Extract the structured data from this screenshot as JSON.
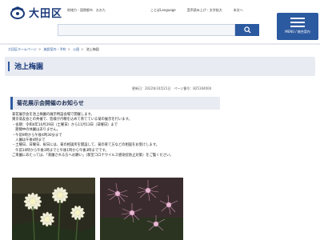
{
  "header": {
    "logo_text": "大田区",
    "logo_sub": "地域力・国際都市　おおた",
    "util_links": [
      "ことばLanguage",
      "音声読み上げ・文字拡大",
      "本文へ"
    ],
    "search_placeholder": "",
    "menu_label": "MENU / 総合案内"
  },
  "breadcrumb": [
    "大田区ホームページ",
    "施設案内・予約",
    "公園",
    "池上梅園"
  ],
  "page": {
    "title": "池上梅園",
    "meta": "更新日：2022年10月21日　ページ番号：825164004"
  },
  "section": {
    "title": "菊花展示会開催のお知らせ",
    "lines": [
      "菊花展示会を池上梅園の展示特設会場で開催します。",
      "東京菊友会との共催で、皆様が丹精を込めて育てている菊の展示を行います。",
      "・会期：令和4年10月29日（土曜日）から11月13日（日曜日）まで",
      "　期間中の休園はありません。",
      "・午前9時から午後4時30分まで",
      "　入園は午後4時まで",
      "・土曜日、日曜日、祝日には、菊の相談所を開設して、菊の育て方などの相談をお受けします。",
      "　午前10時から午後3時までと午後1時から午後3時までです。",
      "ご来園にあたっては、「来園される方へお願い」（新型コロナウイルス感染症防止対策）をご覧ください。"
    ]
  },
  "photos": [
    {
      "name": "white-chrysanthemum-photo"
    },
    {
      "name": "pink-chrysanthemum-photo"
    }
  ],
  "colors": {
    "brand": "#2c5aa0",
    "title": "#1a3a7a",
    "panel": "#e8ebf2"
  }
}
